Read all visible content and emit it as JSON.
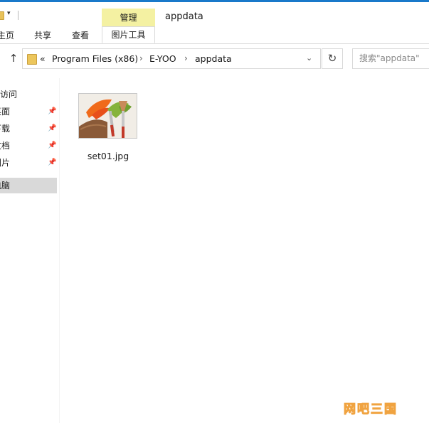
{
  "window": {
    "title": "appdata",
    "contextual_tab_group": "管理"
  },
  "ribbon": {
    "tabs": [
      {
        "label": "主页"
      },
      {
        "label": "共享"
      },
      {
        "label": "查看"
      },
      {
        "label": "图片工具"
      }
    ]
  },
  "address_bar": {
    "overflow": "«",
    "breadcrumbs": [
      "Program Files (x86)",
      "E-YOO",
      "appdata"
    ]
  },
  "search": {
    "placeholder": "搜索\"appdata\""
  },
  "sidebar": {
    "items": [
      {
        "label": "快速访问",
        "pinned": false,
        "selected": false
      },
      {
        "label": "桌面",
        "pinned": true,
        "selected": false
      },
      {
        "label": "下载",
        "pinned": true,
        "selected": false
      },
      {
        "label": "文档",
        "pinned": true,
        "selected": false
      },
      {
        "label": "图片",
        "pinned": true,
        "selected": false
      },
      {
        "label": "此电脑",
        "pinned": false,
        "selected": true
      }
    ]
  },
  "files": [
    {
      "name": "set01.jpg",
      "type": "image"
    }
  ],
  "watermark": "网吧三国",
  "colors": {
    "accent_topline": "#1979ca",
    "contextual_tab": "#f4f1a2",
    "selection": "#d9d9d9",
    "watermark": "#f0a340"
  }
}
